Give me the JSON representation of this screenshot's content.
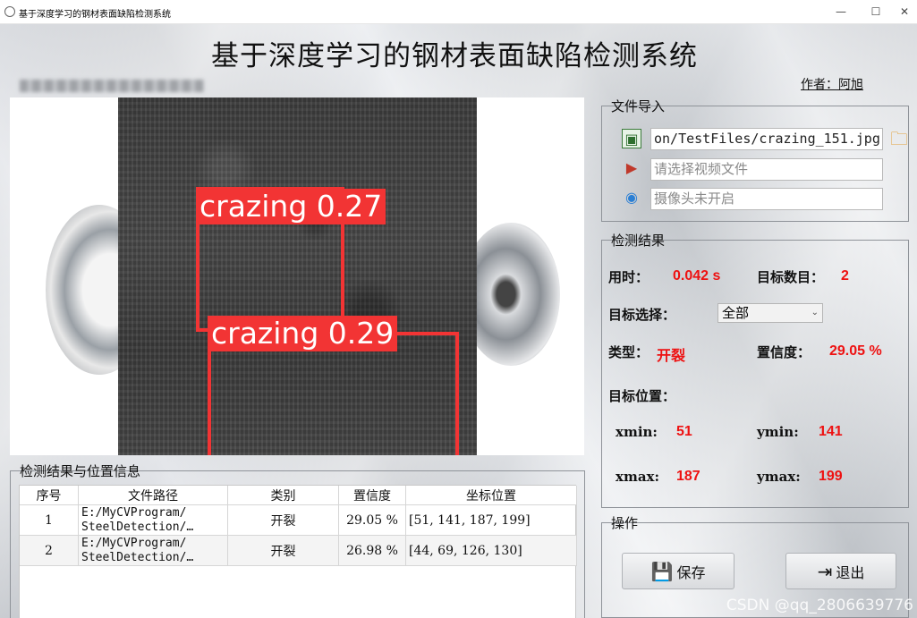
{
  "window": {
    "title": "基于深度学习的钢材表面缺陷检测系统",
    "minimize": "—",
    "maximize": "☐",
    "close": "✕"
  },
  "header": {
    "app_title": "基于深度学习的钢材表面缺陷检测系统",
    "author": "作者：阿旭"
  },
  "display": {
    "detections": [
      {
        "label": "crazing 0.27"
      },
      {
        "label": "crazing 0.29"
      }
    ]
  },
  "file_import": {
    "title": "文件导入",
    "image_path": "on/TestFiles/crazing_151.jpg",
    "video_placeholder": "请选择视频文件",
    "camera_placeholder": "摄像头未开启",
    "icons": [
      "image-icon",
      "video-icon",
      "camera-icon",
      "folder-icon"
    ]
  },
  "results": {
    "title": "检测结果",
    "time_label": "用时：",
    "time_value": "0.042 s",
    "count_label": "目标数目：",
    "count_value": "2",
    "target_select_label": "目标选择：",
    "target_select_value": "全部",
    "type_label": "类型：",
    "type_value": "开裂",
    "conf_label": "置信度：",
    "conf_value": "29.05 %",
    "pos_label": "目标位置：",
    "xmin_label": "xmin:",
    "xmin_value": "51",
    "ymin_label": "ymin:",
    "ymin_value": "141",
    "xmax_label": "xmax:",
    "xmax_value": "187",
    "ymax_label": "ymax:",
    "ymax_value": "199"
  },
  "table_panel": {
    "title": "检测结果与位置信息",
    "headers": [
      "序号",
      "文件路径",
      "类别",
      "置信度",
      "坐标位置"
    ],
    "rows": [
      {
        "index": "1",
        "path_line1": "E:/MyCVProgram/",
        "path_line2": "SteelDetection/…",
        "category": "开裂",
        "confidence": "29.05 %",
        "coords": "[51,  141,  187,  199]"
      },
      {
        "index": "2",
        "path_line1": "E:/MyCVProgram/",
        "path_line2": "SteelDetection/…",
        "category": "开裂",
        "confidence": "26.98 %",
        "coords": "[44,  69,  126,  130]"
      }
    ]
  },
  "actions": {
    "title": "操作",
    "save_label": "保存",
    "exit_label": "退出"
  },
  "watermark": "CSDN @qq_2806639776",
  "colors": {
    "accent_red": "#ee1111",
    "bbox_red": "#f23434"
  }
}
